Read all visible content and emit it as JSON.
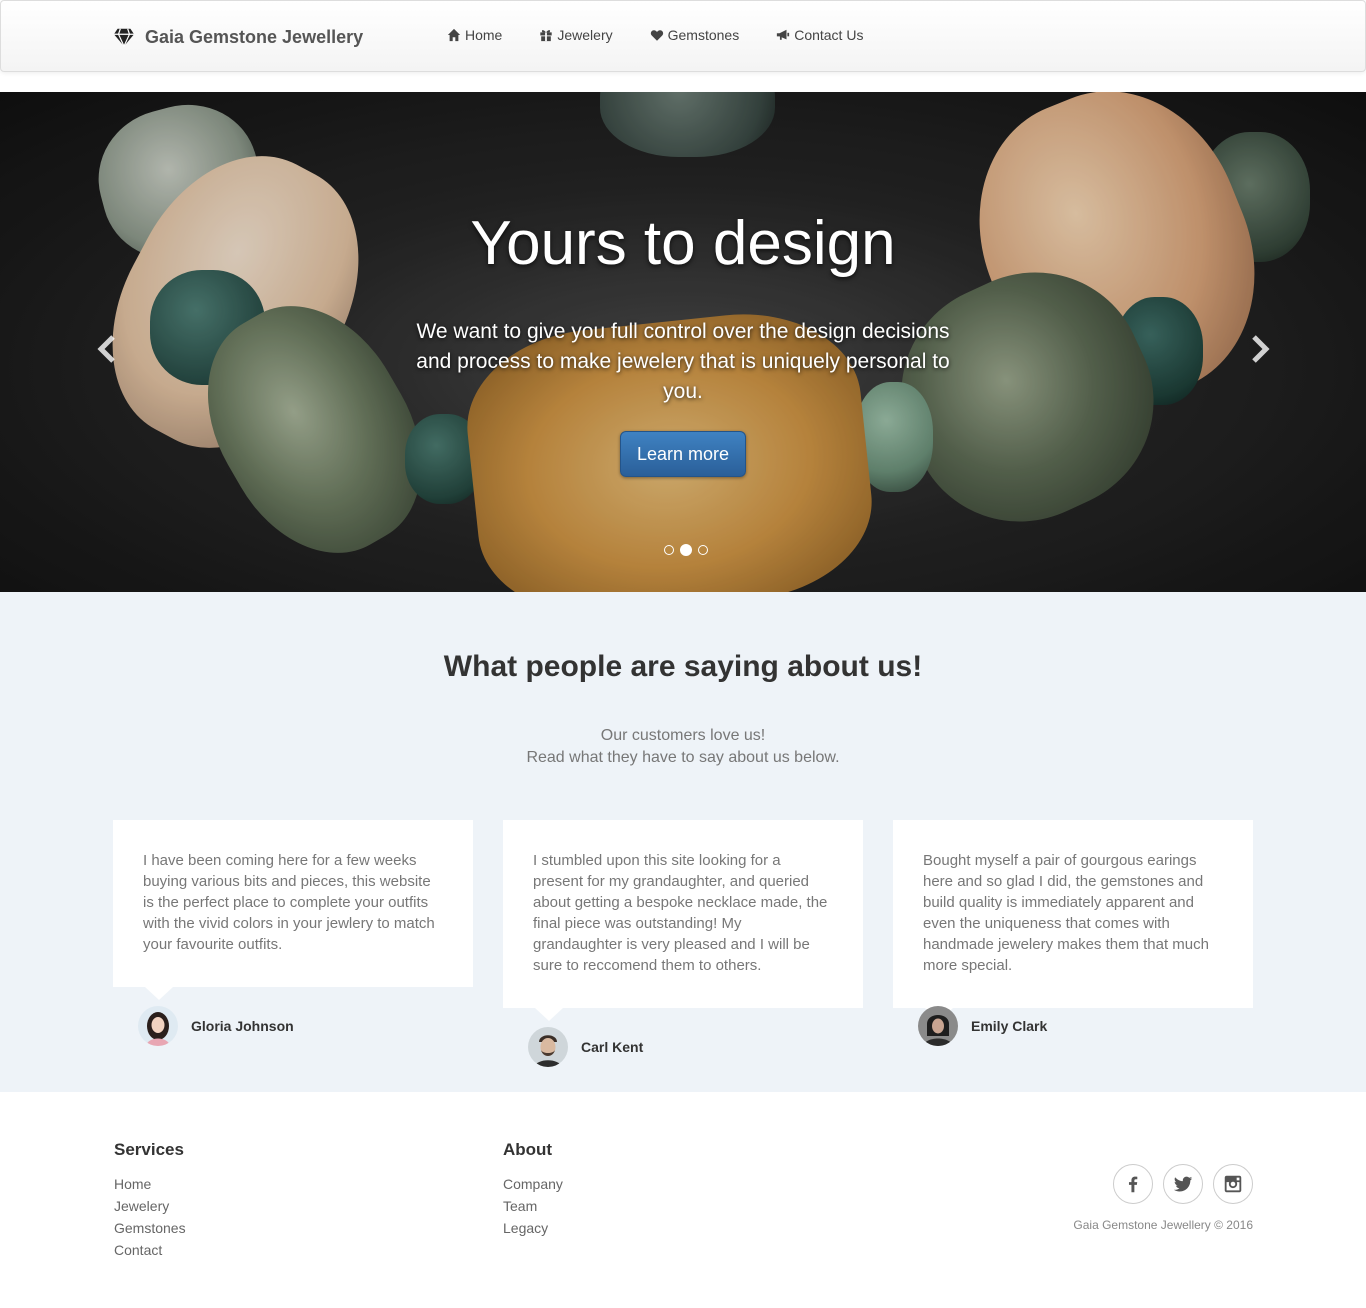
{
  "brand": {
    "name": "Gaia Gemstone Jewellery",
    "icon": "diamond-icon"
  },
  "nav": {
    "items": [
      {
        "label": "Home",
        "icon": "home-icon"
      },
      {
        "label": "Jewelery",
        "icon": "gift-icon"
      },
      {
        "label": "Gemstones",
        "icon": "heart-icon"
      },
      {
        "label": "Contact Us",
        "icon": "megaphone-icon"
      }
    ]
  },
  "hero": {
    "title": "Yours to design",
    "text": "We want to give you full control over the design decisions and process to make jewelery that is uniquely personal to you.",
    "button": "Learn more",
    "slides_count": 3,
    "active_slide": 2
  },
  "testimonials": {
    "heading": "What people are saying about us!",
    "subtitle_line1": "Our customers love us!",
    "subtitle_line2": "Read what they have to say about us below.",
    "items": [
      {
        "quote": "I have been coming here for a few weeks buying various bits and pieces, this website is the perfect place to complete your outfits with the vivid colors in your jewlery to match your favourite outfits.",
        "name": "Gloria Johnson"
      },
      {
        "quote": "I stumbled upon this site looking for a present for my grandaughter, and queried about getting a bespoke necklace made, the final piece was outstanding! My grandaughter is very pleased and I will be sure to reccomend them to others.",
        "name": "Carl Kent"
      },
      {
        "quote": "Bought myself a pair of gourgous earings here and so glad I did, the gemstones and build quality is immediately apparent and even the uniqueness that comes with handmade jewelery makes them that much more special.",
        "name": "Emily Clark"
      }
    ]
  },
  "footer": {
    "services": {
      "heading": "Services",
      "links": [
        "Home",
        "Jewelery",
        "Gemstones",
        "Contact"
      ]
    },
    "about": {
      "heading": "About",
      "links": [
        "Company",
        "Team",
        "Legacy"
      ]
    },
    "socials": [
      "facebook-icon",
      "twitter-icon",
      "instagram-icon"
    ],
    "copyright": "Gaia Gemstone Jewellery © 2016"
  },
  "colors": {
    "button_primary": "#337ab7",
    "testimonial_bg": "#eef3f8",
    "text_muted": "#777777"
  }
}
